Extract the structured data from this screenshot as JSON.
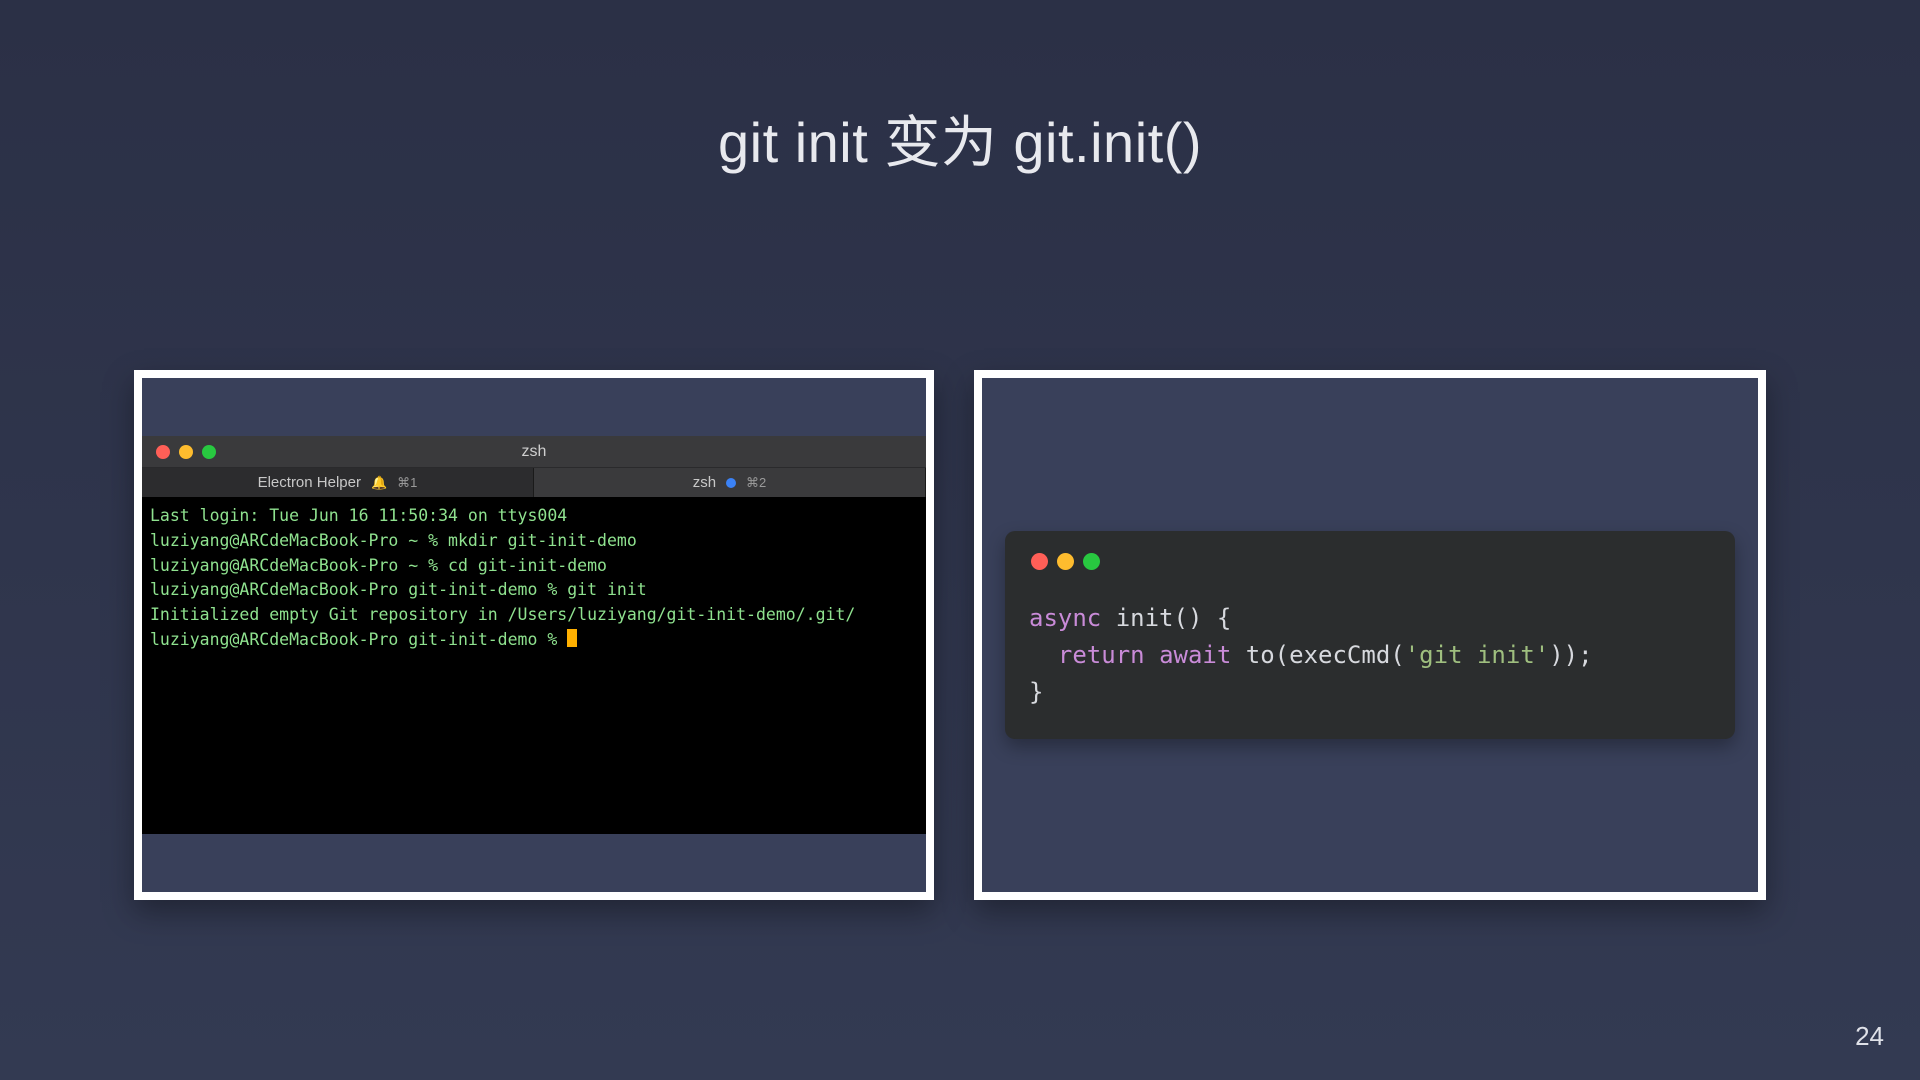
{
  "title": "git init 变为 git.init()",
  "page_number": "24",
  "terminal": {
    "window_title": "zsh",
    "tabs": [
      {
        "label": "Electron Helper",
        "shortcut": "⌘1",
        "has_bell": true,
        "has_dot": false,
        "active": false
      },
      {
        "label": "zsh",
        "shortcut": "⌘2",
        "has_bell": false,
        "has_dot": true,
        "active": true
      }
    ],
    "lines": [
      "Last login: Tue Jun 16 11:50:34 on ttys004",
      "luziyang@ARCdeMacBook-Pro ~ % mkdir git-init-demo",
      "luziyang@ARCdeMacBook-Pro ~ % cd git-init-demo",
      "luziyang@ARCdeMacBook-Pro git-init-demo % git init",
      "Initialized empty Git repository in /Users/luziyang/git-init-demo/.git/",
      "luziyang@ARCdeMacBook-Pro git-init-demo % "
    ]
  },
  "code": {
    "tokens": {
      "kw_async": "async",
      "fn_name": " init",
      "paren_open": "() {",
      "indent": "  ",
      "kw_return": "return",
      "sp1": " ",
      "kw_await": "await",
      "sp2": " ",
      "call_to": "to",
      "paren_to_open": "(",
      "call_exec": "execCmd",
      "paren_exec_open": "(",
      "str": "'git init'",
      "paren_close": "));",
      "brace_close": "}"
    }
  }
}
